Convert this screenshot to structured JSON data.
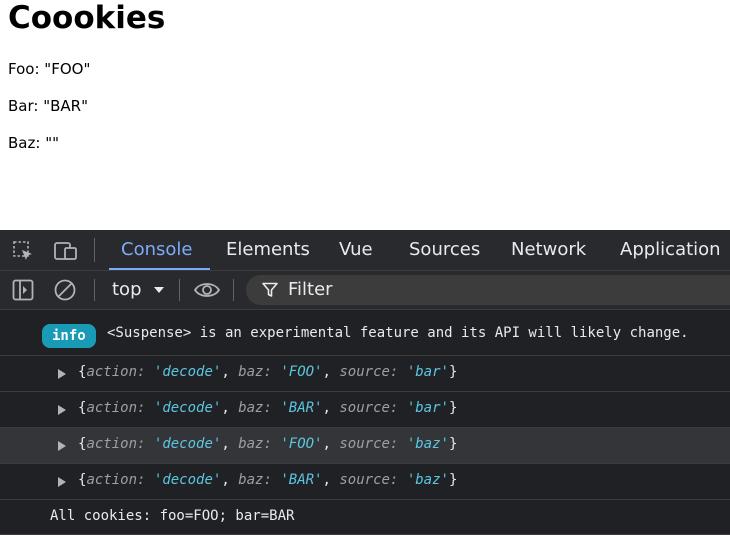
{
  "page": {
    "title": "Coookies",
    "lines": [
      {
        "label": "Foo:",
        "value": "\"FOO\""
      },
      {
        "label": "Bar:",
        "value": "\"BAR\""
      },
      {
        "label": "Baz:",
        "value": "\"\""
      }
    ]
  },
  "devtools": {
    "tabs": [
      "Console",
      "Elements",
      "Vue",
      "Sources",
      "Network",
      "Application"
    ],
    "active_tab": "Console",
    "context": "top",
    "filter_placeholder": "Filter",
    "colors": {
      "accent": "#7cacf8",
      "info_badge": "#1a9bb5",
      "string_value": "#5cc6e0",
      "panel_bg": "#202124"
    },
    "icons": [
      "inspect-element-icon",
      "device-toolbar-icon",
      "sidebar-toggle-icon",
      "clear-console-icon",
      "chevron-down-icon",
      "eye-icon",
      "filter-icon",
      "expand-triangle-icon"
    ],
    "console": {
      "info": {
        "badge": "info",
        "message": "<Suspense> is an experimental feature and its API will likely change."
      },
      "objects": [
        {
          "action": "'decode'",
          "baz": "'FOO'",
          "source": "'bar'"
        },
        {
          "action": "'decode'",
          "baz": "'BAR'",
          "source": "'bar'"
        },
        {
          "action": "'decode'",
          "baz": "'FOO'",
          "source": "'baz'"
        },
        {
          "action": "'decode'",
          "baz": "'BAR'",
          "source": "'baz'"
        }
      ],
      "keys": {
        "action": "action:",
        "baz": "baz:",
        "source": "source:"
      },
      "log": "All cookies: foo=FOO; bar=BAR"
    }
  }
}
